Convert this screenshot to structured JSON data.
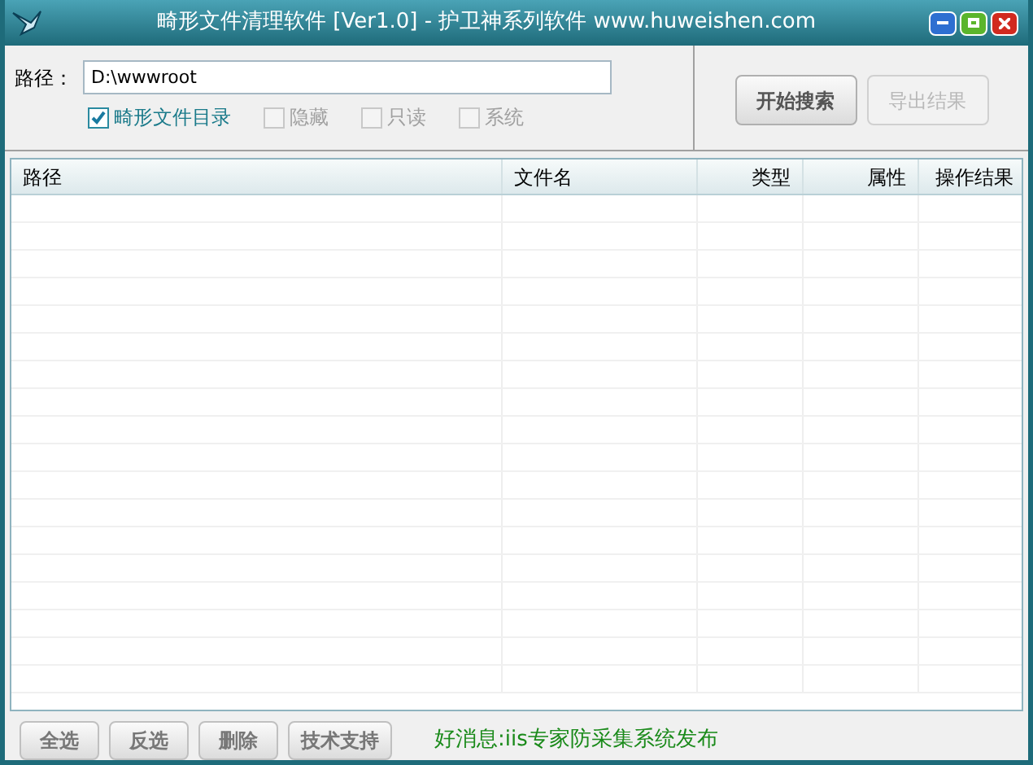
{
  "window": {
    "title": "畸形文件清理软件 [Ver1.0] - 护卫神系列软件 www.huweishen.com"
  },
  "path_field": {
    "label": "路径：",
    "value": "D:\\wwwroot"
  },
  "options": [
    {
      "label": "畸形文件目录",
      "checked": true,
      "disabled": false
    },
    {
      "label": "隐藏",
      "checked": false,
      "disabled": true
    },
    {
      "label": "只读",
      "checked": false,
      "disabled": true
    },
    {
      "label": "系统",
      "checked": false,
      "disabled": true
    }
  ],
  "actions": [
    {
      "label": "开始搜索",
      "disabled": false
    },
    {
      "label": "导出结果",
      "disabled": true
    }
  ],
  "table": {
    "columns": [
      {
        "label": "路径"
      },
      {
        "label": "文件名"
      },
      {
        "label": "类型"
      },
      {
        "label": "属性"
      },
      {
        "label": "操作结果"
      }
    ]
  },
  "bottom_buttons": [
    "全选",
    "反选",
    "删除",
    "技术支持"
  ],
  "news": "好消息:iis专家防采集系统发布"
}
